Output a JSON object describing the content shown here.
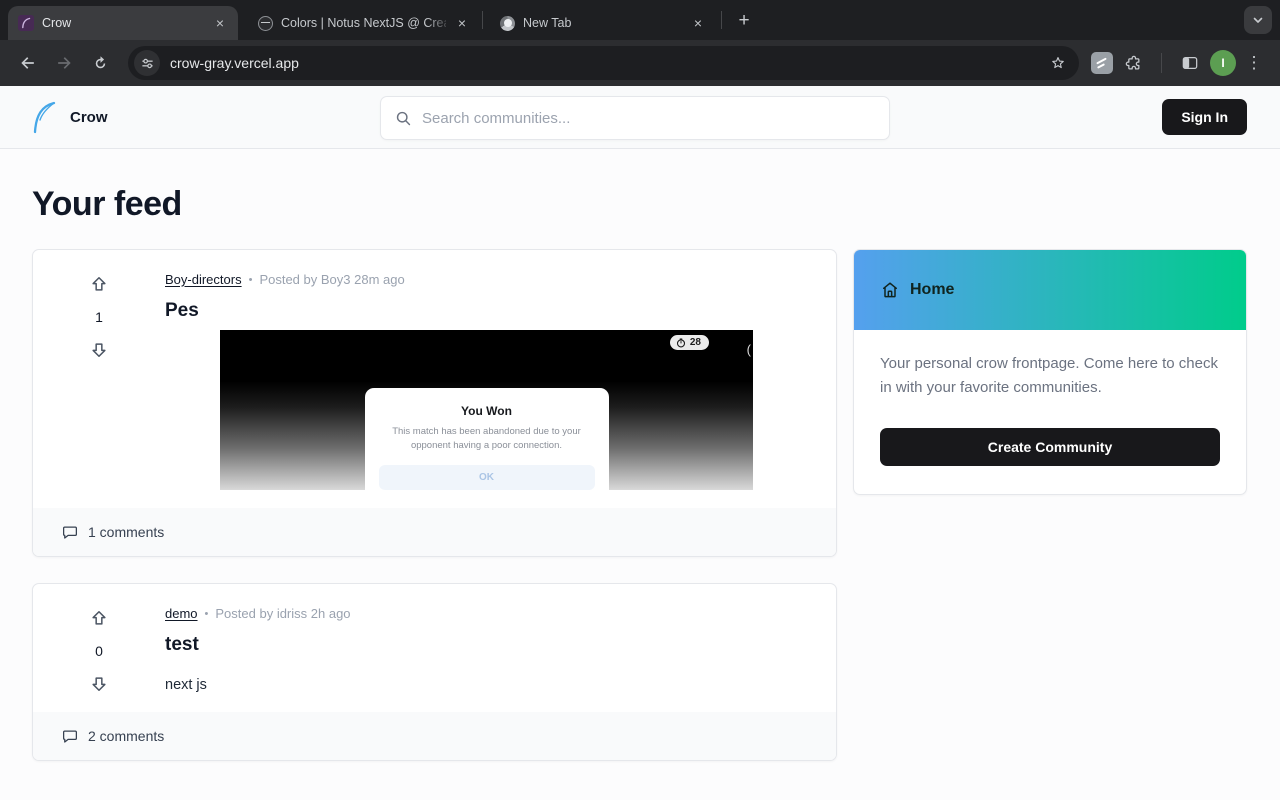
{
  "browser": {
    "tabs": [
      {
        "title": "Crow"
      },
      {
        "title": "Colors | Notus NextJS @ Crea"
      },
      {
        "title": "New Tab"
      }
    ],
    "close_glyph": "×",
    "new_tab_glyph": "+",
    "url": "crow-gray.vercel.app",
    "avatar_initial": "I",
    "kebab_glyph": "⋮"
  },
  "ui": {
    "bullet": "•"
  },
  "header": {
    "brand": "Crow",
    "search_placeholder": "Search communities...",
    "sign_in_label": "Sign In"
  },
  "page": {
    "title": "Your feed"
  },
  "posts": [
    {
      "community": "Boy-directors",
      "meta": "Posted by Boy3 28m ago",
      "title": "Pes",
      "votes": "1",
      "comments_label": "1 comments",
      "image": {
        "timer_badge": "28",
        "paren": "(",
        "modal_title": "You Won",
        "modal_body": "This match has been abandoned due to your opponent having a poor connection.",
        "modal_button": "OK"
      }
    },
    {
      "community": "demo",
      "meta": "Posted by idriss 2h ago",
      "title": "test",
      "body": "next js",
      "votes": "0",
      "comments_label": "2 comments"
    }
  ],
  "sidebar": {
    "title": "Home",
    "description": "Your personal crow frontpage. Come here to check in with your favorite communities.",
    "button_label": "Create Community"
  },
  "colors": {
    "sidebar_gradient_from": "#55a0ee",
    "sidebar_gradient_to": "#00cc8b",
    "primary_button": "#18181b",
    "logo_blue": "#45a7e8",
    "avatar_green": "#5c9e52"
  }
}
